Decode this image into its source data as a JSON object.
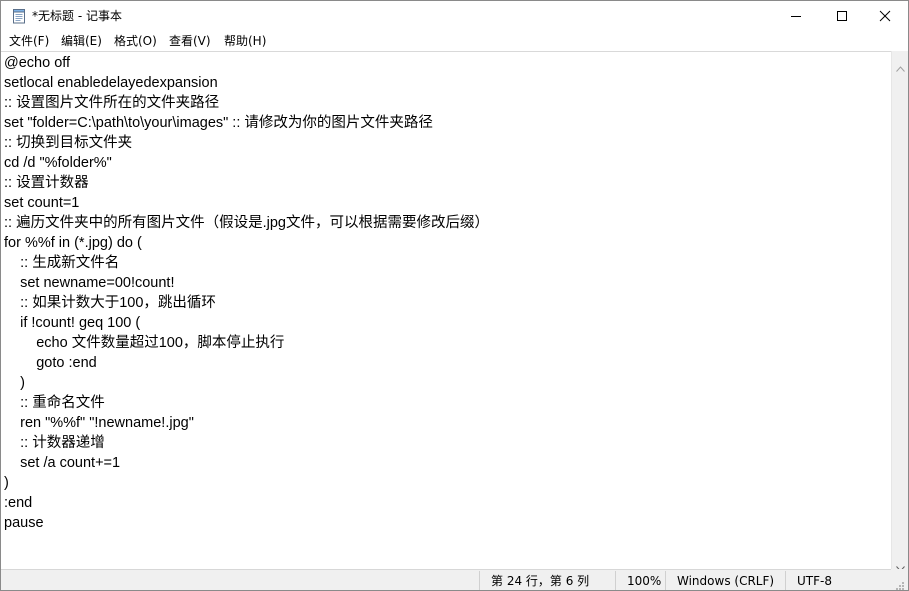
{
  "window": {
    "title": "*无标题 - 记事本",
    "app_icon": "notepad-icon",
    "controls": {
      "minimize": "minimize-icon",
      "maximize": "maximize-icon",
      "close": "close-icon"
    }
  },
  "menu": {
    "items": [
      {
        "label": "文件(F)"
      },
      {
        "label": "编辑(E)"
      },
      {
        "label": "格式(O)"
      },
      {
        "label": "查看(V)"
      },
      {
        "label": "帮助(H)"
      }
    ]
  },
  "editor": {
    "text": "@echo off\nsetlocal enabledelayedexpansion\n:: 设置图片文件所在的文件夹路径\nset \"folder=C:\\path\\to\\your\\images\" :: 请修改为你的图片文件夹路径\n:: 切换到目标文件夹\ncd /d \"%folder%\"\n:: 设置计数器\nset count=1\n:: 遍历文件夹中的所有图片文件（假设是.jpg文件，可以根据需要修改后缀）\nfor %%f in (*.jpg) do (\n    :: 生成新文件名\n    set newname=00!count!\n    :: 如果计数大于100，跳出循环\n    if !count! geq 100 (\n        echo 文件数量超过100，脚本停止执行\n        goto :end\n    )\n    :: 重命名文件\n    ren \"%%f\" \"!newname!.jpg\"\n    :: 计数器递增\n    set /a count+=1\n)\n:end\npause"
  },
  "status": {
    "position": "第 24 行，第 6 列",
    "zoom": "100%",
    "line_ending": "Windows (CRLF)",
    "encoding": "UTF-8"
  },
  "colors": {
    "chrome": "#f0f0f0",
    "text": "#000000",
    "background": "#ffffff"
  }
}
